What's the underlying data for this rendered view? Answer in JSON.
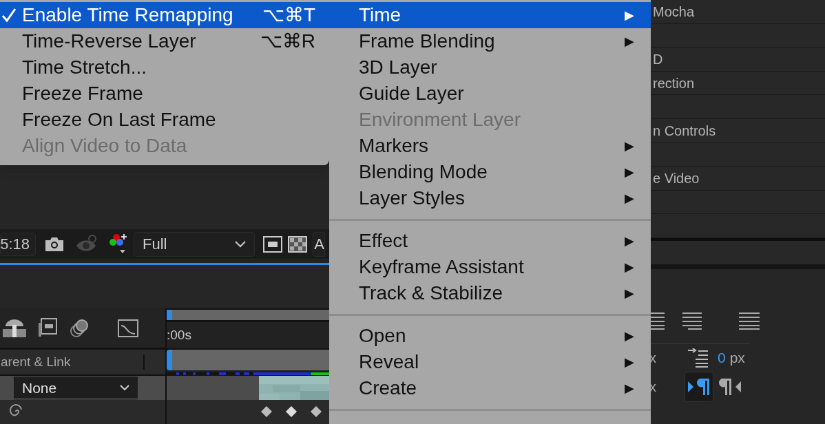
{
  "submenu": {
    "items": [
      {
        "label": "Enable Time Remapping",
        "shortcut": "⌥⌘T",
        "checked": true,
        "selected": true,
        "disabled": false
      },
      {
        "label": "Time-Reverse Layer",
        "shortcut": "⌥⌘R",
        "checked": false,
        "selected": false,
        "disabled": false
      },
      {
        "label": "Time Stretch...",
        "checked": false,
        "selected": false,
        "disabled": false
      },
      {
        "label": "Freeze Frame",
        "checked": false,
        "selected": false,
        "disabled": false
      },
      {
        "label": "Freeze On Last Frame",
        "checked": false,
        "selected": false,
        "disabled": false
      },
      {
        "label": "Align Video to Data",
        "checked": false,
        "selected": false,
        "disabled": true
      }
    ]
  },
  "menu": {
    "items": [
      {
        "kind": "item",
        "label": "Time",
        "selected": true,
        "disabled": false,
        "arrow": "▶"
      },
      {
        "kind": "item",
        "label": "Frame Blending",
        "selected": false,
        "disabled": false,
        "arrow": "▶"
      },
      {
        "kind": "item",
        "label": "3D Layer",
        "selected": false,
        "disabled": false
      },
      {
        "kind": "item",
        "label": "Guide Layer",
        "selected": false,
        "disabled": false
      },
      {
        "kind": "item",
        "label": "Environment Layer",
        "selected": false,
        "disabled": true
      },
      {
        "kind": "item",
        "label": "Markers",
        "selected": false,
        "disabled": false,
        "arrow": "▶"
      },
      {
        "kind": "item",
        "label": "Blending Mode",
        "selected": false,
        "disabled": false,
        "arrow": "▶"
      },
      {
        "kind": "item",
        "label": "Layer Styles",
        "selected": false,
        "disabled": false,
        "arrow": "▶"
      },
      {
        "kind": "separator"
      },
      {
        "kind": "item",
        "label": "Effect",
        "selected": false,
        "disabled": false,
        "arrow": "▶"
      },
      {
        "kind": "item",
        "label": "Keyframe Assistant",
        "selected": false,
        "disabled": false,
        "arrow": "▶"
      },
      {
        "kind": "item",
        "label": "Track & Stabilize",
        "selected": false,
        "disabled": false,
        "arrow": "▶"
      },
      {
        "kind": "separator"
      },
      {
        "kind": "item",
        "label": "Open",
        "selected": false,
        "disabled": false,
        "arrow": "▶"
      },
      {
        "kind": "item",
        "label": "Reveal",
        "selected": false,
        "disabled": false,
        "arrow": "▶"
      },
      {
        "kind": "item",
        "label": "Create",
        "selected": false,
        "disabled": false,
        "arrow": "▶"
      },
      {
        "kind": "separator"
      }
    ]
  },
  "viewer_toolbar": {
    "timecode": "5:18",
    "resolution": "Full",
    "button_cut": "A"
  },
  "timeline": {
    "time_label": ":00s",
    "column_header": "arent & Link",
    "parent_value": "None"
  },
  "effects_list": {
    "items": [
      {
        "kind": "entry",
        "label": "Mocha"
      },
      {
        "kind": "blank"
      },
      {
        "kind": "entry",
        "label": "D"
      },
      {
        "kind": "entry",
        "label": "rection"
      },
      {
        "kind": "blank"
      },
      {
        "kind": "entry",
        "label": "n Controls"
      },
      {
        "kind": "blank"
      },
      {
        "kind": "entry",
        "label": "e Video"
      },
      {
        "kind": "blank"
      },
      {
        "kind": "blank"
      }
    ]
  },
  "paragraph_panel": {
    "indent_label_1": "x",
    "indent_label_2": "x",
    "indent_value": "0",
    "indent_unit": "px"
  }
}
